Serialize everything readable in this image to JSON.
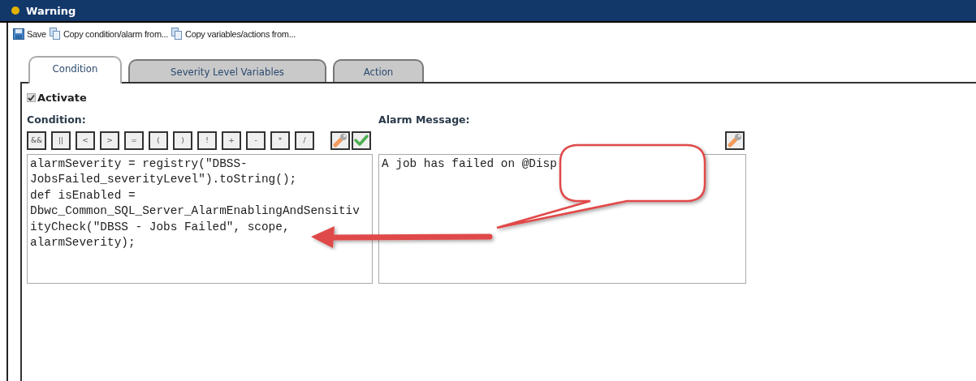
{
  "window": {
    "title": "Warning"
  },
  "toolbar": [
    {
      "kind": "save",
      "label": "Save"
    },
    {
      "kind": "copy",
      "label": "Copy condition/alarm from..."
    },
    {
      "kind": "copy",
      "label": "Copy variables/actions from..."
    }
  ],
  "tabs": [
    {
      "label": "Condition",
      "selected": true
    },
    {
      "label": "Severity Level Variables",
      "selected": false
    },
    {
      "label": "Action",
      "selected": false
    }
  ],
  "activate": {
    "label": "Activate",
    "checked": true
  },
  "condition": {
    "label": "Condition:",
    "operators": [
      "&&",
      "||",
      "<",
      ">",
      "=",
      "(",
      ")",
      "!",
      "+",
      "-",
      "*",
      "/"
    ],
    "tools": [
      {
        "kind": "wrench"
      },
      {
        "kind": "check"
      }
    ],
    "value": "alarmSeverity = registry(\"DBSS-\nJobsFailed_severityLevel\").toString();\ndef isEnabled =\nDbwc_Common_SQL_Server_AlarmEnablingAndSensitiv\nityCheck(\"DBSS - Jobs Failed\", scope,\nalarmSeverity);"
  },
  "alarm_message": {
    "label": "Alarm Message:",
    "tools": [
      {
        "kind": "wrench"
      }
    ],
    "value": "A job has failed on @Disp"
  },
  "annotation": {
    "kind": "callout"
  }
}
